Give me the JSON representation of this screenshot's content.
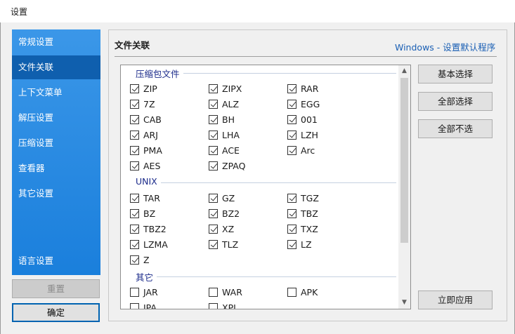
{
  "window": {
    "title": "设置"
  },
  "sidebar": {
    "items": [
      {
        "label": "常规设置"
      },
      {
        "label": "文件关联"
      },
      {
        "label": "上下文菜单"
      },
      {
        "label": "解压设置"
      },
      {
        "label": "压缩设置"
      },
      {
        "label": "查看器"
      },
      {
        "label": "其它设置"
      },
      {
        "label": "语言设置"
      }
    ],
    "selected": "文件关联",
    "reset_label": "重置",
    "ok_label": "确定"
  },
  "main": {
    "title": "文件关联",
    "default_link": "Windows - 设置默认程序",
    "groups": [
      {
        "label": "压缩包文件",
        "items": [
          {
            "label": "ZIP",
            "checked": true
          },
          {
            "label": "ZIPX",
            "checked": true
          },
          {
            "label": "RAR",
            "checked": true
          },
          {
            "label": "7Z",
            "checked": true
          },
          {
            "label": "ALZ",
            "checked": true
          },
          {
            "label": "EGG",
            "checked": true
          },
          {
            "label": "CAB",
            "checked": true
          },
          {
            "label": "BH",
            "checked": true
          },
          {
            "label": "001",
            "checked": true
          },
          {
            "label": "ARJ",
            "checked": true
          },
          {
            "label": "LHA",
            "checked": true
          },
          {
            "label": "LZH",
            "checked": true
          },
          {
            "label": "PMA",
            "checked": true
          },
          {
            "label": "ACE",
            "checked": true
          },
          {
            "label": "Arc",
            "checked": true
          },
          {
            "label": "AES",
            "checked": true
          },
          {
            "label": "ZPAQ",
            "checked": true
          }
        ]
      },
      {
        "label": "UNIX",
        "items": [
          {
            "label": "TAR",
            "checked": true
          },
          {
            "label": "GZ",
            "checked": true
          },
          {
            "label": "TGZ",
            "checked": true
          },
          {
            "label": "BZ",
            "checked": true
          },
          {
            "label": "BZ2",
            "checked": true
          },
          {
            "label": "TBZ",
            "checked": true
          },
          {
            "label": "TBZ2",
            "checked": true
          },
          {
            "label": "XZ",
            "checked": true
          },
          {
            "label": "TXZ",
            "checked": true
          },
          {
            "label": "LZMA",
            "checked": true
          },
          {
            "label": "TLZ",
            "checked": true
          },
          {
            "label": "LZ",
            "checked": true
          },
          {
            "label": "Z",
            "checked": true
          }
        ]
      },
      {
        "label": "其它",
        "items": [
          {
            "label": "JAR",
            "checked": false
          },
          {
            "label": "WAR",
            "checked": false
          },
          {
            "label": "APK",
            "checked": false
          },
          {
            "label": "IPA",
            "checked": false
          },
          {
            "label": "XPI",
            "checked": false
          }
        ]
      }
    ],
    "buttons": {
      "basic": "基本选择",
      "select_all": "全部选择",
      "select_none": "全部不选",
      "apply": "立即应用"
    }
  },
  "scrollbar": {
    "up_icon": "chevron-up-icon",
    "down_icon": "chevron-down-icon"
  }
}
